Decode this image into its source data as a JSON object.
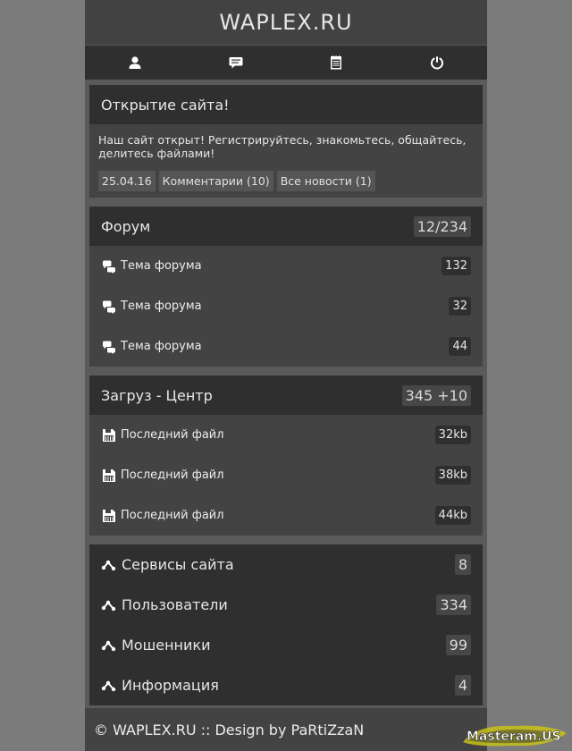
{
  "site_title": "WAPLEX.RU",
  "nav": {
    "items": [
      {
        "icon": "user-icon"
      },
      {
        "icon": "chat-icon"
      },
      {
        "icon": "notepad-icon"
      },
      {
        "icon": "power-icon"
      }
    ]
  },
  "news": {
    "title": "Открытие сайта!",
    "text": "Наш сайт открыт! Регистрируйтесь, знакомьтесь, общайтесь, делитесь файлами!",
    "date": "25.04.16",
    "comments": "Комментарии (10)",
    "all_news": "Все новости (1)"
  },
  "forum": {
    "title": "Форум",
    "count": "12/234",
    "items": [
      {
        "label": "Тема форума",
        "count": "132"
      },
      {
        "label": "Тема форума",
        "count": "32"
      },
      {
        "label": "Тема форума",
        "count": "44"
      }
    ]
  },
  "downloads": {
    "title": "Загруз - Центр",
    "count": "345 +10",
    "items": [
      {
        "label": "Последний файл",
        "size": "32kb"
      },
      {
        "label": "Последний файл",
        "size": "38kb"
      },
      {
        "label": "Последний файл",
        "size": "44kb"
      }
    ]
  },
  "services": {
    "items": [
      {
        "label": "Сервисы сайта",
        "count": "8"
      },
      {
        "label": "Пользователи",
        "count": "334"
      },
      {
        "label": "Мошенники",
        "count": "99"
      },
      {
        "label": "Информация",
        "count": "4"
      }
    ]
  },
  "footer": {
    "text": "© WAPLEX.RU :: Design by PaRtiZzaN"
  },
  "watermark": {
    "text": "Masteram.US"
  }
}
